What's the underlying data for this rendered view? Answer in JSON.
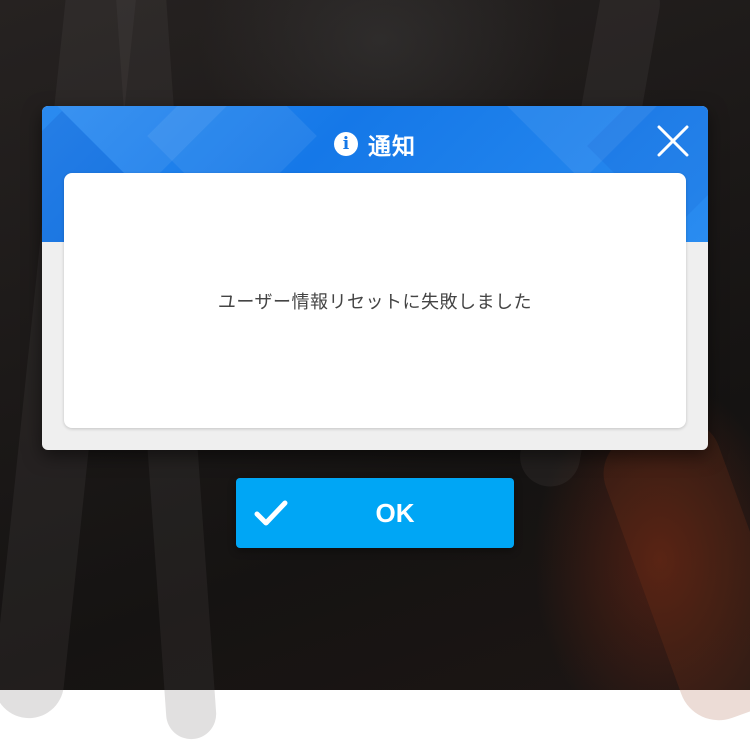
{
  "dialog": {
    "title": "通知",
    "title_icon": "info-icon",
    "close_icon": "close-icon",
    "message": "ユーザー情報リセットに失敗しました"
  },
  "ok_button": {
    "label": "OK",
    "icon": "check-icon"
  },
  "colors": {
    "header_blue": "#1578e8",
    "button_blue": "#00a6f5",
    "panel_gray": "#efefef",
    "message_text": "#444444"
  }
}
